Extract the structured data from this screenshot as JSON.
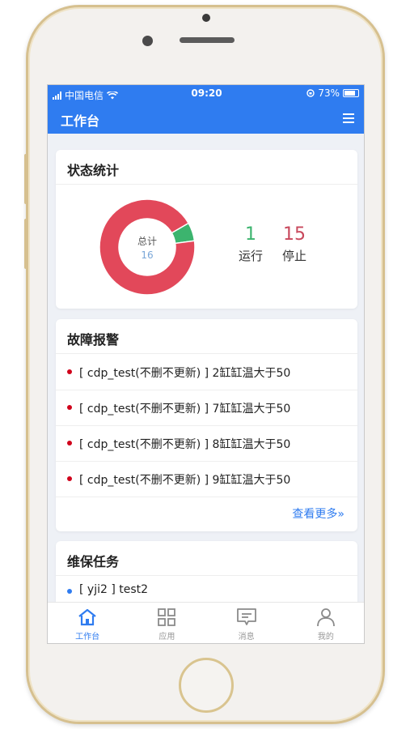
{
  "statusbar": {
    "carrier": "中国电信",
    "time": "09:20",
    "battery": "73%"
  },
  "appbar": {
    "title": "工作台"
  },
  "status_card": {
    "title": "状态统计",
    "donut_label": "总计",
    "total": "16",
    "running_value": "1",
    "running_label": "运行",
    "stopped_value": "15",
    "stopped_label": "停止",
    "running_count": 1,
    "stopped_count": 15,
    "colors": {
      "running": "#3cb46e",
      "stopped": "#e2485a"
    }
  },
  "alarm_card": {
    "title": "故障报警",
    "items": [
      "[ cdp_test(不删不更新) ] 2缸缸温大于50",
      "[ cdp_test(不删不更新) ] 7缸缸温大于50",
      "[ cdp_test(不删不更新) ] 8缸缸温大于50",
      "[ cdp_test(不删不更新) ] 9缸缸温大于50"
    ],
    "more": "查看更多»"
  },
  "task_card": {
    "title": "维保任务",
    "items": [
      "[ yji2 ] test2"
    ]
  },
  "tabbar": {
    "items": [
      {
        "label": "工作台",
        "icon": "home-icon",
        "active": true
      },
      {
        "label": "应用",
        "icon": "grid-icon",
        "active": false
      },
      {
        "label": "消息",
        "icon": "message-icon",
        "active": false
      },
      {
        "label": "我的",
        "icon": "user-icon",
        "active": false
      }
    ]
  },
  "accent_color": "#2f7cf0"
}
